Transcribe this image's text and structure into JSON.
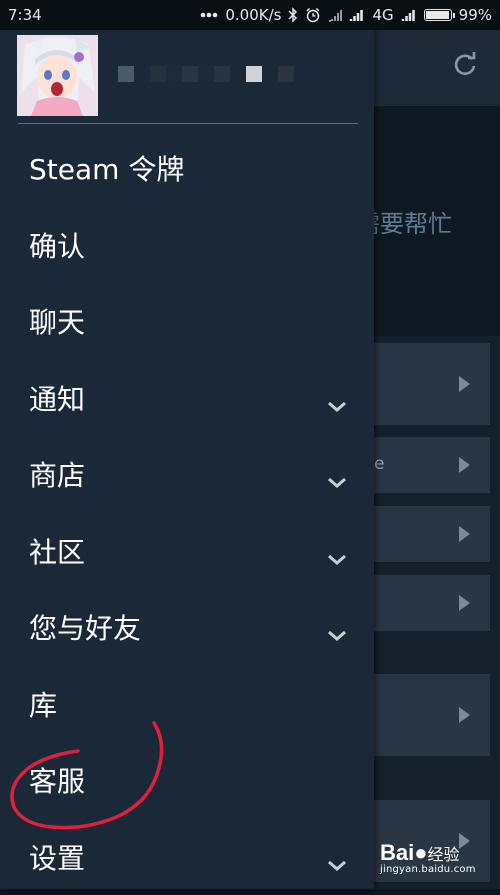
{
  "status_bar": {
    "time": "7:34",
    "network_speed": "0.00K/s",
    "network_type": "4G",
    "battery_percent": "99%",
    "battery_level": 0.99,
    "icons": [
      "more-dots-icon",
      "bluetooth-icon",
      "alarm-icon",
      "signal-icon",
      "battery-icon"
    ]
  },
  "drawer": {
    "username": "",
    "menu": [
      {
        "label": "Steam 令牌",
        "expandable": false
      },
      {
        "label": "确认",
        "expandable": false
      },
      {
        "label": "聊天",
        "expandable": false
      },
      {
        "label": "通知",
        "expandable": true
      },
      {
        "label": "商店",
        "expandable": true
      },
      {
        "label": "社区",
        "expandable": true
      },
      {
        "label": "您与好友",
        "expandable": true
      },
      {
        "label": "库",
        "expandable": false
      },
      {
        "label": "客服",
        "expandable": false
      },
      {
        "label": "设置",
        "expandable": true
      }
    ]
  },
  "background": {
    "help_text": "需要帮忙",
    "row_text": "e"
  },
  "annotation": {
    "color": "#e0203a"
  },
  "watermark": {
    "logo": "Bai",
    "logo_suffix": "经验",
    "url": "jingyan.baidu.com"
  },
  "colors": {
    "drawer_bg": "#1b2838",
    "text": "#ffffff",
    "divider": "#5b7183"
  }
}
